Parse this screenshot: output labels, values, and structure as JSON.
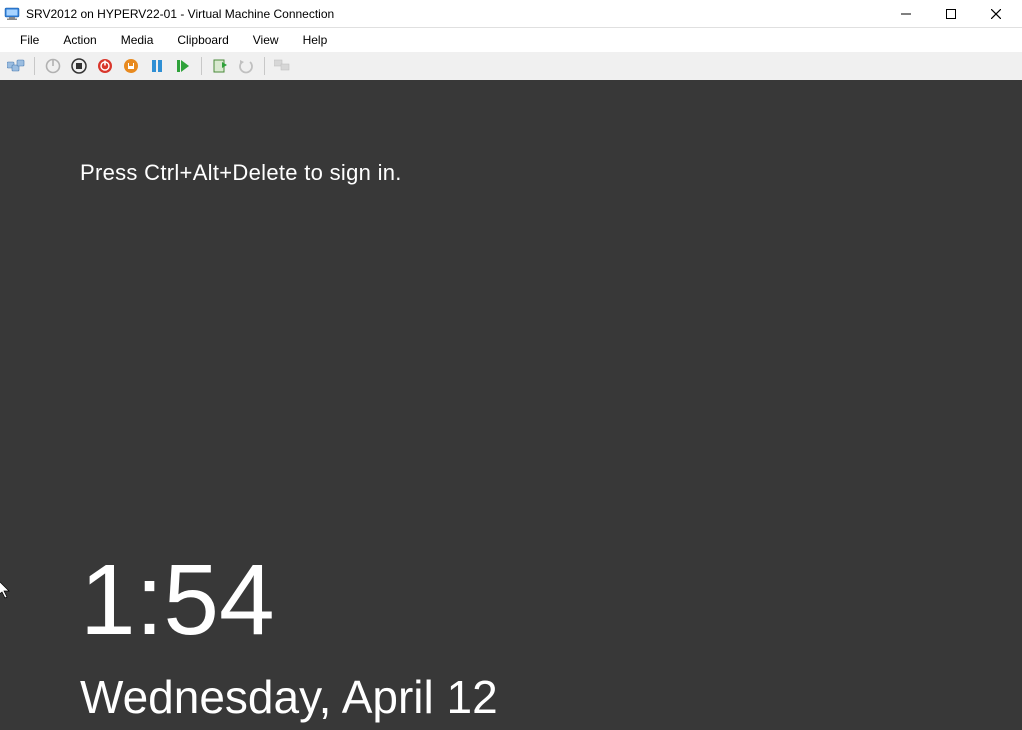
{
  "window": {
    "title": "SRV2012 on HYPERV22-01 - Virtual Machine Connection"
  },
  "menu": {
    "items": [
      "File",
      "Action",
      "Media",
      "Clipboard",
      "View",
      "Help"
    ]
  },
  "toolbar": {
    "icons": [
      "ctrl-alt-del",
      "start",
      "turn-off",
      "shutdown",
      "save",
      "pause",
      "reset",
      "checkpoint",
      "revert",
      "share"
    ]
  },
  "lockscreen": {
    "prompt": "Press Ctrl+Alt+Delete to sign in.",
    "time": "1:54",
    "date": "Wednesday, April 12"
  }
}
